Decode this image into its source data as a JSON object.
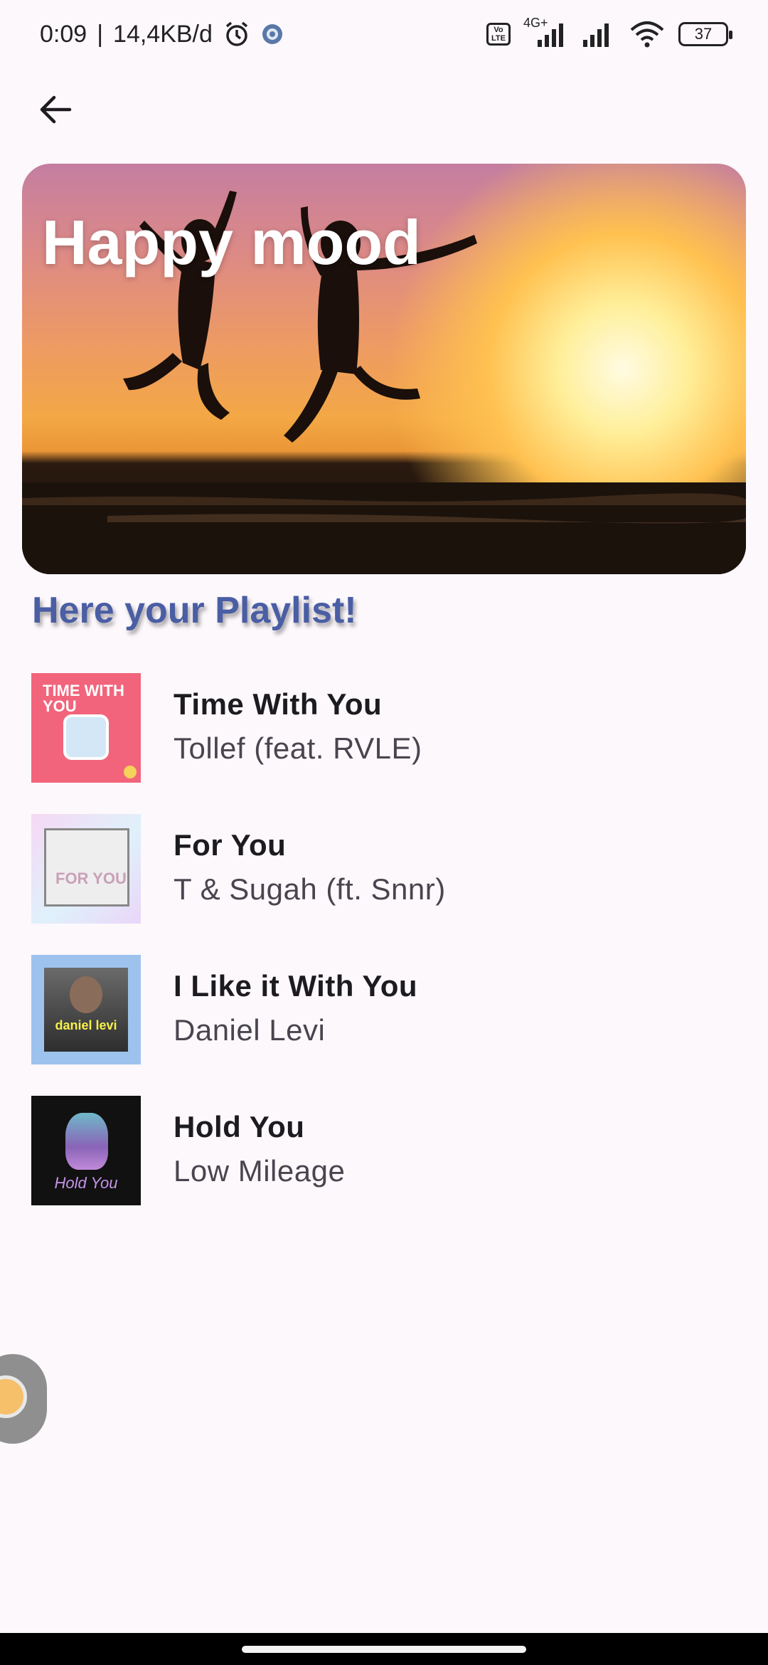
{
  "status_bar": {
    "time": "0:09",
    "separator": "|",
    "data_rate": "14,4KB/d",
    "volte_top": "Vo",
    "volte_bottom": "LTE",
    "network": "4G+",
    "battery": "37"
  },
  "header": {
    "back_icon": "arrow-left-icon"
  },
  "hero": {
    "title": "Happy mood"
  },
  "section": {
    "title": "Here your Playlist!"
  },
  "playlist": [
    {
      "title": "Time With You",
      "artist": "Tollef (feat. RVLE)",
      "cover_text": "TIME WITH YOU"
    },
    {
      "title": "For You",
      "artist": "T & Sugah (ft. Snnr)",
      "cover_text": "FOR YOU"
    },
    {
      "title": "I Like it With You",
      "artist": "Daniel Levi",
      "cover_text": "daniel levi"
    },
    {
      "title": "Hold You",
      "artist": "Low Mileage",
      "cover_text": "Hold You"
    }
  ],
  "colors": {
    "background": "#fdf8fc",
    "section_title": "#4a5ea4",
    "track_title": "#1c1b1f",
    "track_artist": "#49454f"
  }
}
